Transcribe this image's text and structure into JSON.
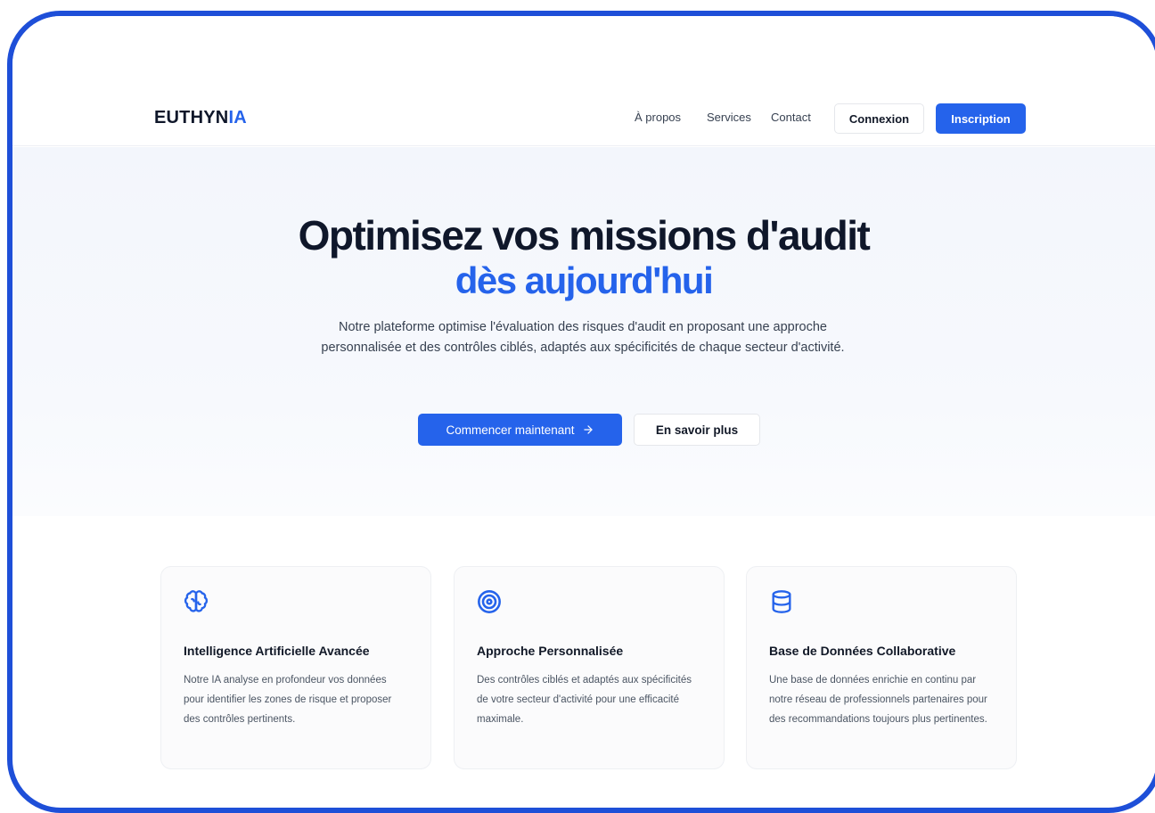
{
  "brand": {
    "name_main": "EUTHYN",
    "name_accent": "IA",
    "accent_color": "#2563eb"
  },
  "nav": {
    "links": [
      "À propos",
      "Services",
      "Contact"
    ],
    "login": "Connexion",
    "signup": "Inscription"
  },
  "hero": {
    "title_line1": "Optimisez vos missions d'audit",
    "title_line2": "dès aujourd'hui",
    "description": "Notre plateforme optimise l'évaluation des risques d'audit en proposant une approche personnalisée et des contrôles ciblés, adaptés aux spécificités de chaque secteur d'activité.",
    "primary_cta": "Commencer maintenant",
    "primary_cta_icon": "arrow-right-icon",
    "secondary_cta": "En savoir plus"
  },
  "features": [
    {
      "icon": "brain-icon",
      "title": "Intelligence Artificielle Avancée",
      "description": "Notre IA analyse en profondeur vos données pour identifier les zones de risque et proposer des contrôles pertinents."
    },
    {
      "icon": "target-icon",
      "title": "Approche Personnalisée",
      "description": "Des contrôles ciblés et adaptés aux spécificités de votre secteur d'activité pour une efficacité maximale."
    },
    {
      "icon": "database-icon",
      "title": "Base de Données Collaborative",
      "description": "Une base de données enrichie en continu par notre réseau de professionnels partenaires pour des recommandations toujours plus pertinentes."
    }
  ],
  "colors": {
    "primary": "#2563eb",
    "frame_border": "#1e4fd8",
    "text_dark": "#0f172a"
  }
}
